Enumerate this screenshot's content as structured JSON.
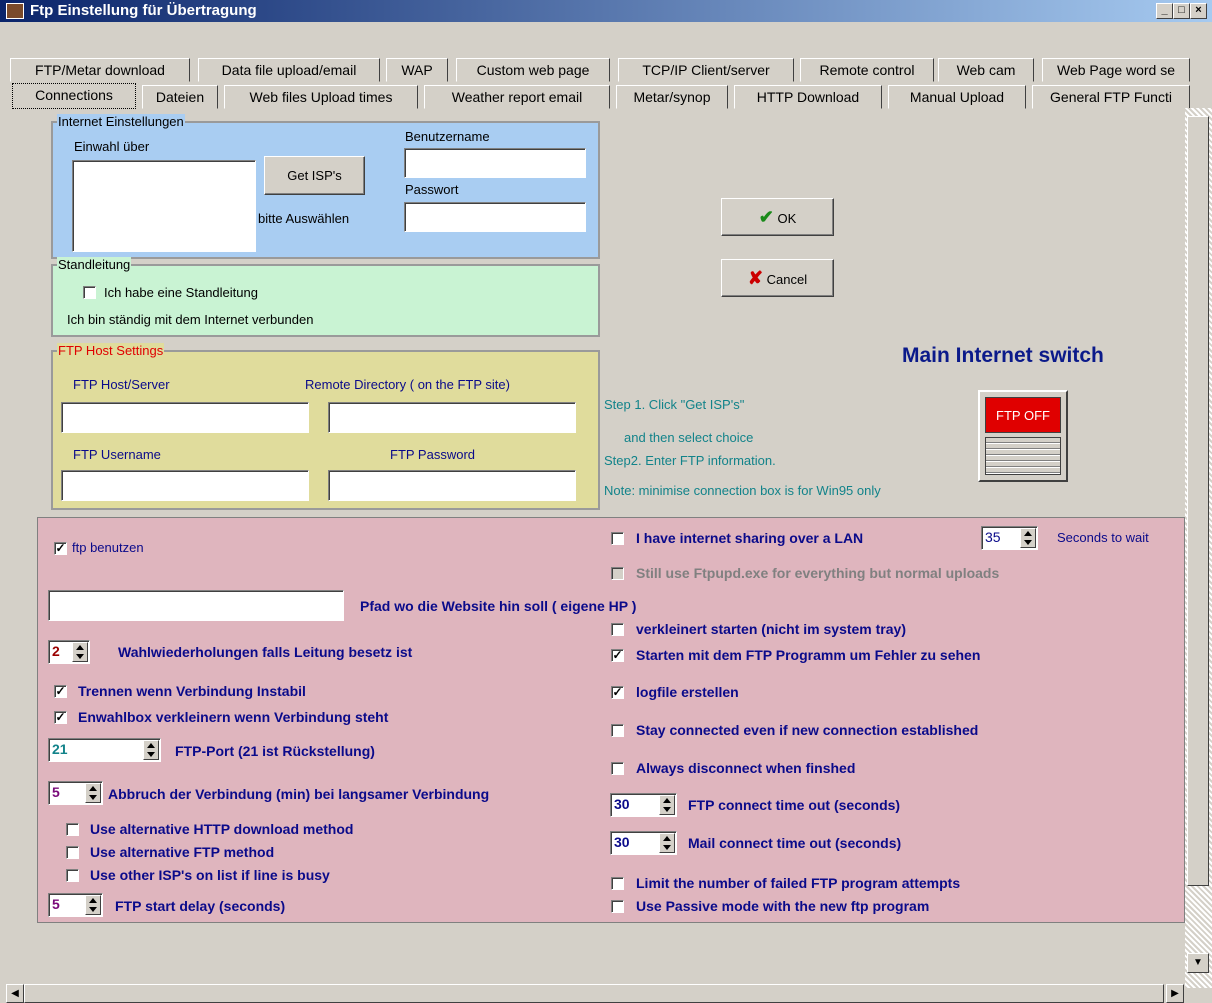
{
  "window": {
    "title": "Ftp Einstellung für Übertragung",
    "min": "_",
    "max": "□",
    "close": "×"
  },
  "tabs_row1": [
    "FTP/Metar download",
    "Data file upload/email",
    "WAP",
    "Custom web page",
    "TCP/IP Client/server",
    "Remote control",
    "Web cam",
    "Web Page word se"
  ],
  "tabs_row2": [
    "Connections",
    "Dateien",
    "Web files Upload times",
    "Weather report email",
    "Metar/synop",
    "HTTP Download",
    "Manual Upload",
    "General FTP Functi"
  ],
  "internet": {
    "legend": "Internet Einstellungen",
    "einwahl": "Einwahl über",
    "get_isp": "Get ISP's",
    "bitte": "bitte Auswählen",
    "benutzer": "Benutzername",
    "passwort": "Passwort"
  },
  "standleitung": {
    "legend": "Standleitung",
    "checkbox": "Ich habe eine Standleitung",
    "info": "Ich bin ständig mit dem Internet verbunden"
  },
  "ftphost": {
    "legend": "FTP Host Settings",
    "host": "FTP Host/Server",
    "remote": "Remote Directory ( on the FTP site)",
    "user": "FTP Username",
    "pass": "FTP Password"
  },
  "buttons": {
    "ok": "OK",
    "cancel": "Cancel"
  },
  "switch": {
    "title": "Main Internet switch",
    "state": "FTP OFF"
  },
  "steps": [
    "Step 1. Click  \"Get ISP's\"",
    "and then select choice",
    "Step2. Enter FTP information.",
    "Note: minimise connection box is for Win95 only"
  ],
  "left": {
    "ftp_benutzen": "ftp benutzen",
    "pfad": "Pfad wo die Website hin soll ( eigene HP )",
    "wahl_val": "2",
    "wahl": "Wahlwiederholungen falls Leitung besetz ist",
    "trennen": "Trennen wenn Verbindung Instabil",
    "einwahlbox": "Enwahlbox verkleinern wenn Verbindung steht",
    "port_val": "21",
    "port": "FTP-Port (21 ist Rückstellung)",
    "abbruch_val": "5",
    "abbruch": "Abbruch der Verbindung (min) bei langsamer Verbindung",
    "alt_http": "Use alternative HTTP download method",
    "alt_ftp": "Use alternative FTP method",
    "other_isp": "Use other ISP's on list if line is busy",
    "delay_val": "5",
    "delay": "FTP start delay (seconds)"
  },
  "right": {
    "lan": "I have internet sharing over a LAN",
    "wait_val": "35",
    "wait": "Seconds to wait",
    "still": "Still use Ftpupd.exe for everything but normal uploads",
    "verkleinert": "verkleinert starten (nicht im system tray)",
    "starten": "Starten mit dem FTP Programm um Fehler zu sehen",
    "logfile": "logfile erstellen",
    "stay": "Stay connected even if new connection established",
    "always": "Always disconnect when finshed",
    "ftp_to_val": "30",
    "ftp_to": "FTP connect time out (seconds)",
    "mail_to_val": "30",
    "mail_to": "Mail connect time out (seconds)",
    "limit": "Limit the number of failed FTP program attempts",
    "passive": "Use Passive mode with the new ftp program"
  }
}
